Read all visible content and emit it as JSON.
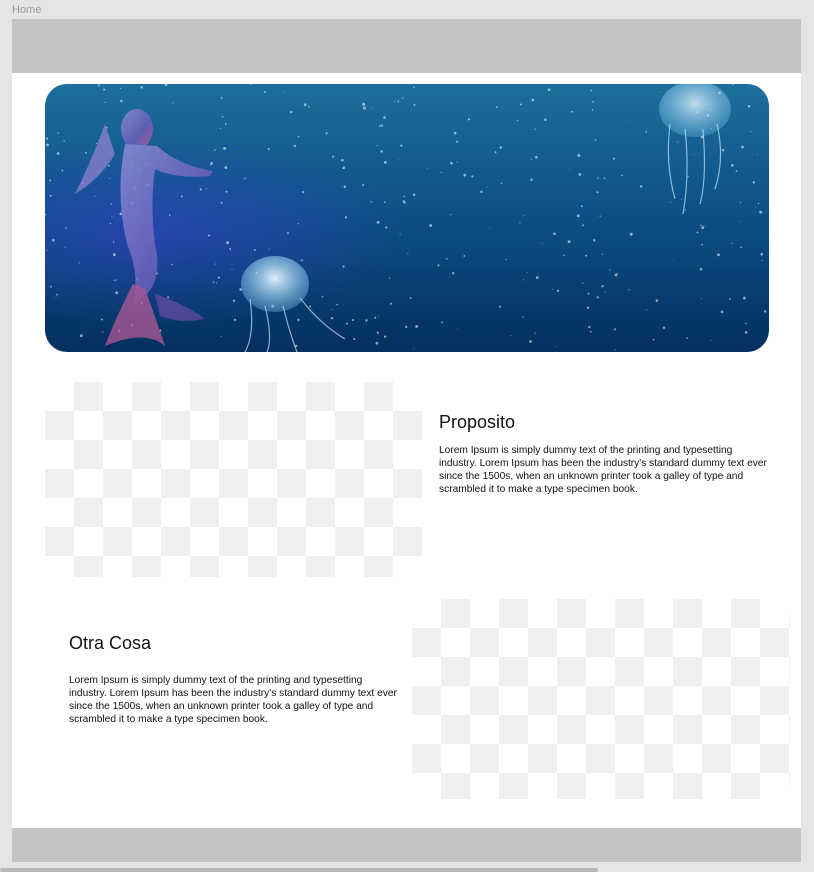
{
  "frame": {
    "label": "Home"
  },
  "hero": {
    "image": "underwater-mermaid-jellyfish-illustration"
  },
  "sections": [
    {
      "title": "Proposito",
      "body": "Lorem Ipsum is simply dummy text of the printing and typesetting industry. Lorem Ipsum has been the industry's standard dummy text ever since the 1500s, when an unknown printer took a galley of type and scrambled it to make a type specimen book."
    },
    {
      "title": "Otra Cosa",
      "body": "Lorem Ipsum is simply dummy text of the printing and typesetting industry. Lorem Ipsum has been the industry's standard dummy text ever since the 1500s, when an unknown printer took a galley of type and scrambled it to make a type specimen book."
    }
  ],
  "colors": {
    "canvas": "#e5e5e5",
    "frame": "#ffffff",
    "bars": "#c4c4c4",
    "ocean_top": "#1d6e9c",
    "ocean_bottom": "#052f5e",
    "checker": "#efefef"
  }
}
